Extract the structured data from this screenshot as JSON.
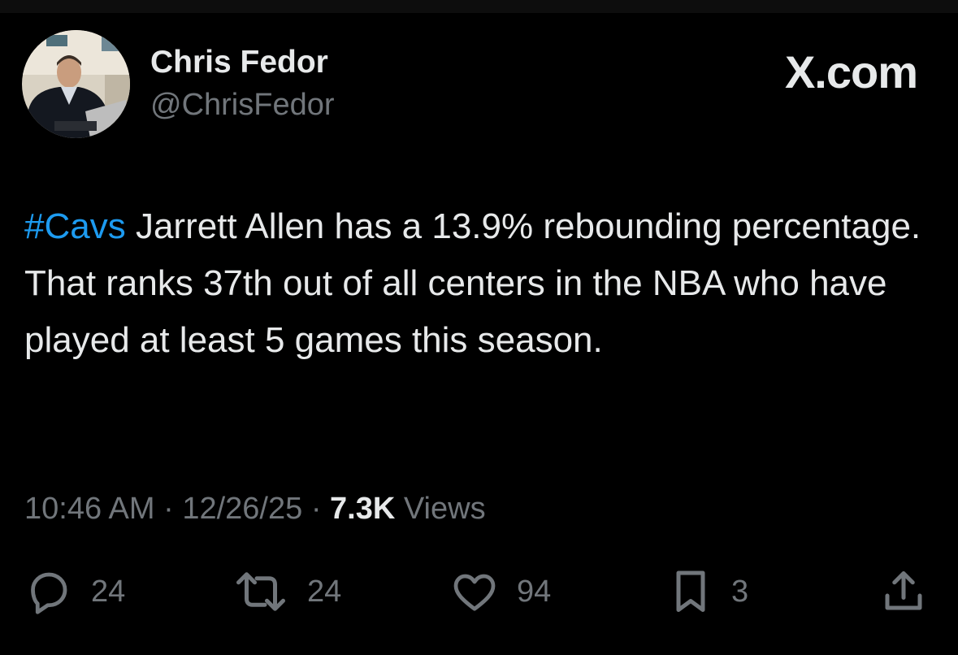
{
  "author": {
    "display_name": "Chris Fedor",
    "handle": "@ChrisFedor"
  },
  "brand": "X.com",
  "tweet": {
    "hashtag": "#Cavs",
    "text": " Jarrett Allen has a 13.9% rebounding percentage. That ranks 37th out of all centers in the NBA who have played at least 5 games this season."
  },
  "meta": {
    "time": "10:46 AM",
    "separator": " · ",
    "date": "12/26/25",
    "views_count": "7.3K",
    "views_label": " Views"
  },
  "actions": {
    "replies": "24",
    "reposts": "24",
    "likes": "94",
    "bookmarks": "3"
  },
  "colors": {
    "background": "#000000",
    "text": "#e7e9ea",
    "secondary_text": "#71767b",
    "hashtag": "#1d9bf0"
  },
  "icons": [
    "reply-icon",
    "repost-icon",
    "like-icon",
    "bookmark-icon",
    "share-icon"
  ]
}
